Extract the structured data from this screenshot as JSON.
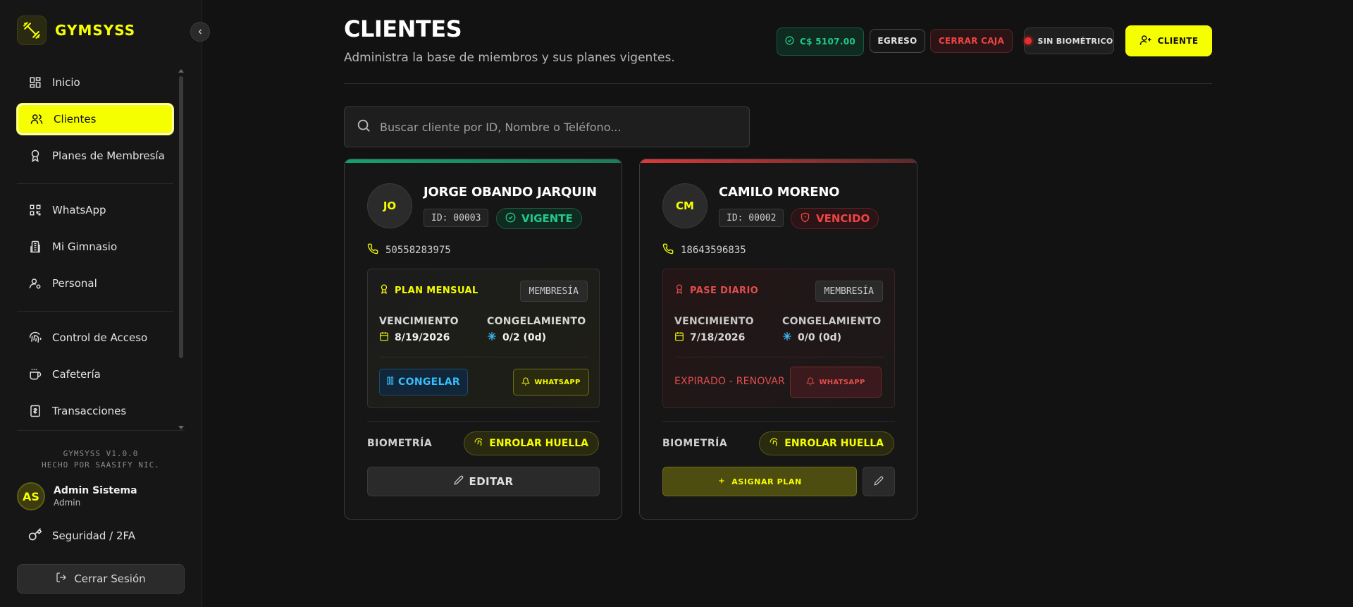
{
  "brand": {
    "name": "GYMSYSS",
    "accent": "#f5ff00"
  },
  "nav": {
    "items": [
      {
        "label": "Inicio"
      },
      {
        "label": "Clientes"
      },
      {
        "label": "Planes de Membresía"
      },
      {
        "label": "WhatsApp"
      },
      {
        "label": "Mi Gimnasio"
      },
      {
        "label": "Personal"
      },
      {
        "label": "Control de Acceso"
      },
      {
        "label": "Cafetería"
      },
      {
        "label": "Transacciones"
      }
    ]
  },
  "footer": {
    "version": "GYMSYSS V1.0.0",
    "made_by": "HECHO POR SAASIFY NIC.",
    "user_initials": "AS",
    "user_name": "Admin Sistema",
    "user_role": "Admin",
    "security": "Seguridad / 2FA",
    "logout": "Cerrar Sesión"
  },
  "header": {
    "title": "CLIENTES",
    "subtitle": "Administra la base de miembros y sus planes vigentes.",
    "cash": "C$ 5107.00",
    "egreso": "EGRESO",
    "cerrar_caja": "CERRAR CAJA",
    "biometric": "SIN BIOMÉTRICO",
    "new_client": "CLIENTE"
  },
  "search": {
    "placeholder": "Buscar cliente por ID, Nombre o Teléfono..."
  },
  "clients": [
    {
      "initials": "JO",
      "name": "JORGE OBANDO JARQUIN",
      "id": "ID: 00003",
      "status": "VIGENTE",
      "phone": "50558283975",
      "plan": "PLAN MENSUAL",
      "tag": "MEMBRESÍA",
      "exp_label": "VENCIMIENTO",
      "exp": "8/19/2026",
      "freeze_label": "CONGELAMIENTO",
      "freeze": "0/2 (0d)",
      "freeze_btn": "CONGELAR",
      "whatsapp": "WHATSAPP",
      "bio_label": "BIOMETRÍA",
      "enroll": "ENROLAR HUELLA",
      "edit": "EDITAR"
    },
    {
      "initials": "CM",
      "name": "CAMILO MORENO",
      "id": "ID: 00002",
      "status": "VENCIDO",
      "phone": "18643596835",
      "plan": "PASE DIARIO",
      "tag": "MEMBRESÍA",
      "exp_label": "VENCIMIENTO",
      "exp": "7/18/2026",
      "freeze_label": "CONGELAMIENTO",
      "freeze": "0/0 (0d)",
      "expired_note": "EXPIRADO - RENOVAR",
      "whatsapp": "WHATSAPP",
      "bio_label": "BIOMETRÍA",
      "enroll": "ENROLAR HUELLA",
      "assign": "ASIGNAR PLAN"
    }
  ],
  "colors": {
    "green": "#22c98a",
    "red": "#ef4444",
    "blue": "#38bdf8"
  }
}
